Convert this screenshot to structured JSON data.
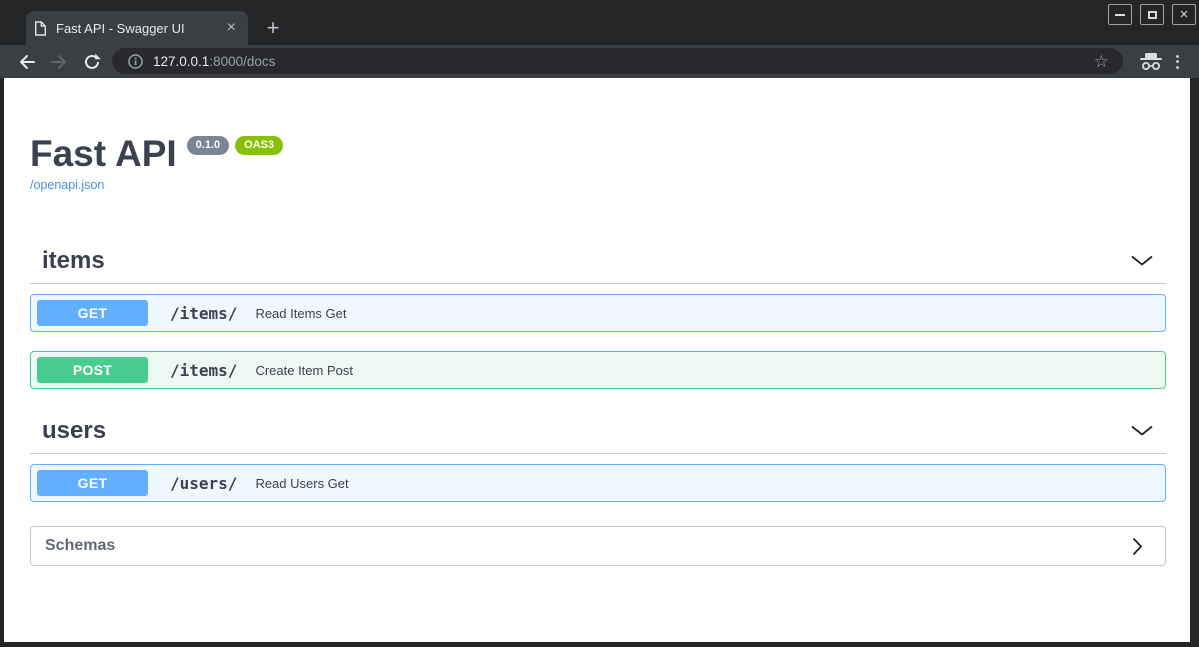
{
  "browser": {
    "tab_title": "Fast API - Swagger UI",
    "url_host": "127.0.0.1",
    "url_path": ":8000/docs"
  },
  "glyphs": {
    "tab_close": "×",
    "new_tab": "+",
    "window_close": "×",
    "bookmark_star": "☆"
  },
  "page": {
    "title": "Fast API",
    "version_badge": "0.1.0",
    "oas_badge": "OAS3",
    "spec_link": "/openapi.json",
    "schemas_label": "Schemas",
    "sections": [
      {
        "name": "items",
        "operations": [
          {
            "method": "GET",
            "path": "/items/",
            "summary": "Read Items Get"
          },
          {
            "method": "POST",
            "path": "/items/",
            "summary": "Create Item Post"
          }
        ]
      },
      {
        "name": "users",
        "operations": [
          {
            "method": "GET",
            "path": "/users/",
            "summary": "Read Users Get"
          }
        ]
      }
    ]
  },
  "colors": {
    "get_method": "#61affe",
    "post_method": "#49cc90",
    "get_row_bg": "#eff7ff",
    "post_row_bg": "#edfaf4",
    "version_badge_bg": "#7d8492",
    "oas3_badge_bg": "#89bf04",
    "link": "#4990e2",
    "heading_text": "#3b4151",
    "chrome_dark": "#232527",
    "chrome_toolbar": "#3b3e42"
  }
}
